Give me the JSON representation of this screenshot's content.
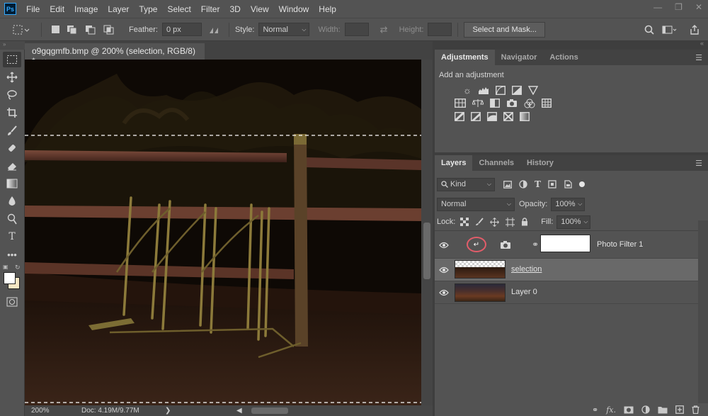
{
  "app": {
    "logo": "Ps",
    "menu": [
      "File",
      "Edit",
      "Image",
      "Layer",
      "Type",
      "Select",
      "Filter",
      "3D",
      "View",
      "Window",
      "Help"
    ]
  },
  "options_bar": {
    "feather_label": "Feather:",
    "feather_value": "0 px",
    "style_label": "Style:",
    "style_value": "Normal",
    "width_label": "Width:",
    "height_label": "Height:",
    "select_mask_button": "Select and Mask..."
  },
  "document": {
    "tab_title": "o9gqgmfb.bmp @ 200% (selection, RGB/8) *",
    "zoom": "200%",
    "doc_info": "Doc: 4.19M/9.77M"
  },
  "adjustments_panel": {
    "tabs": [
      "Adjustments",
      "Navigator",
      "Actions"
    ],
    "active_tab": "Adjustments",
    "add_label": "Add an adjustment"
  },
  "layers_panel": {
    "tabs": [
      "Layers",
      "Channels",
      "History"
    ],
    "active_tab": "Layers",
    "filter_kind": "Kind",
    "blend_mode": "Normal",
    "opacity_label": "Opacity:",
    "opacity_value": "100%",
    "lock_label": "Lock:",
    "fill_label": "Fill:",
    "fill_value": "100%",
    "layers": [
      {
        "name": "Photo Filter 1",
        "kind": "adjustment",
        "visible": true,
        "selected": false
      },
      {
        "name": "selection",
        "kind": "pixel",
        "visible": true,
        "selected": true
      },
      {
        "name": "Layer 0",
        "kind": "pixel",
        "visible": true,
        "selected": false
      }
    ]
  },
  "colors": {
    "ui_bg": "#535353",
    "panel_dark": "#424242",
    "selected_layer": "#696969",
    "clip_highlight": "#e35d6a",
    "foreground_color": "#ffffff",
    "background_color": "#f5e6c4"
  }
}
